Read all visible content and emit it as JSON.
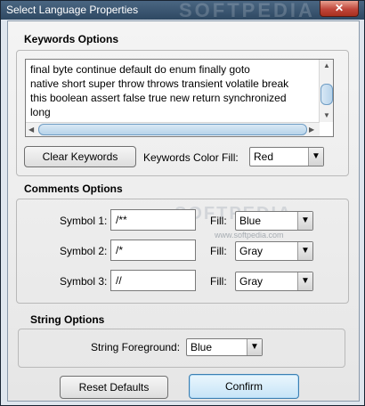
{
  "window": {
    "title": "Select Language Properties",
    "close_glyph": "✕",
    "watermark": "SOFTPEDIA"
  },
  "keywords": {
    "heading": "Keywords Options",
    "text": "final byte continue default do enum finally goto\nnative short super throw throws transient volatile break\nthis boolean assert false true new return synchronized\nlong",
    "clear_label": "Clear Keywords",
    "color_fill_label": "Keywords Color Fill:",
    "color_fill_value": "Red"
  },
  "comments": {
    "heading": "Comments Options",
    "rows": [
      {
        "symbol_label": "Symbol 1:",
        "symbol_value": "/**",
        "fill_label": "Fill:",
        "fill_value": "Blue"
      },
      {
        "symbol_label": "Symbol 2:",
        "symbol_value": "/*",
        "fill_label": "Fill:",
        "fill_value": "Gray"
      },
      {
        "symbol_label": "Symbol 3:",
        "symbol_value": "//",
        "fill_label": "Fill:",
        "fill_value": "Gray"
      }
    ],
    "watermark": "SOFTPEDIA",
    "watermark_small": "www.softpedia.com"
  },
  "string": {
    "heading": "String Options",
    "foreground_label": "String Foreground:",
    "foreground_value": "Blue"
  },
  "footer": {
    "reset_label": "Reset Defaults",
    "confirm_label": "Confirm"
  }
}
